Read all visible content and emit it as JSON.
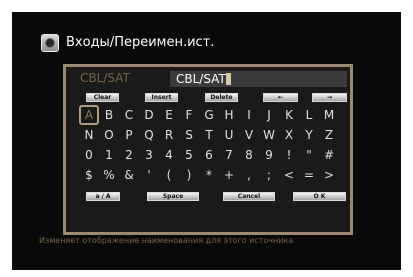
{
  "header": {
    "title": "Входы/Переимен.ист."
  },
  "name_editor": {
    "current_label": "CBL/SAT",
    "edit_value": "CBL/SAT"
  },
  "keyboard": {
    "top_buttons": [
      "Clear",
      "Insert",
      "Delete",
      "←",
      "→"
    ],
    "rows": [
      [
        "A",
        "B",
        "C",
        "D",
        "E",
        "F",
        "G",
        "H",
        "I",
        "J",
        "K",
        "L",
        "M"
      ],
      [
        "N",
        "O",
        "P",
        "Q",
        "R",
        "S",
        "T",
        "U",
        "V",
        "W",
        "X",
        "Y",
        "Z"
      ],
      [
        "0",
        "1",
        "2",
        "3",
        "4",
        "5",
        "6",
        "7",
        "8",
        "9",
        "!",
        "\"",
        "#"
      ],
      [
        "$",
        "%",
        "&",
        "'",
        "(",
        ")",
        "*",
        "+",
        ",",
        ";",
        "<",
        "=",
        ">"
      ]
    ],
    "selected_key": "A",
    "bottom_buttons": [
      "a / A",
      "Space",
      "Cancel",
      "O K"
    ]
  },
  "footer": {
    "text": "Изменяет отображение наименования для этого источника"
  }
}
